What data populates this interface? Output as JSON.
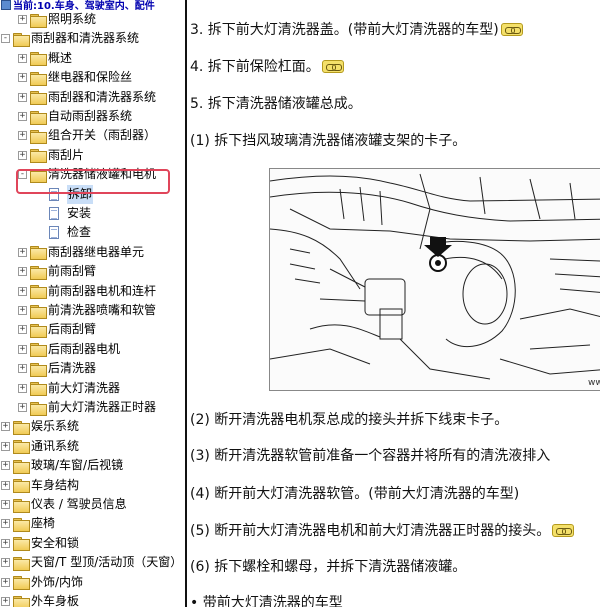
{
  "tree": {
    "header": "当前:10.车身、驾驶室内、配件",
    "items": [
      {
        "label": "照明系统",
        "level": 1,
        "type": "folder",
        "expander": "+"
      },
      {
        "label": "雨刮器和清洗器系统",
        "level": 0,
        "type": "folder",
        "expander": "-"
      },
      {
        "label": "概述",
        "level": 1,
        "type": "folder",
        "expander": "+"
      },
      {
        "label": "继电器和保险丝",
        "level": 1,
        "type": "folder",
        "expander": "+"
      },
      {
        "label": "雨刮器和清洗器系统",
        "level": 1,
        "type": "folder",
        "expander": "+"
      },
      {
        "label": "自动雨刮器系统",
        "level": 1,
        "type": "folder",
        "expander": "+"
      },
      {
        "label": "组合开关（雨刮器）",
        "level": 1,
        "type": "folder",
        "expander": "+"
      },
      {
        "label": "雨刮片",
        "level": 1,
        "type": "folder",
        "expander": "+"
      },
      {
        "label": "清洗器储液罐和电机",
        "level": 1,
        "type": "folder",
        "expander": "-"
      },
      {
        "label": "拆卸",
        "level": 2,
        "type": "doc",
        "selected": true
      },
      {
        "label": "安装",
        "level": 2,
        "type": "doc"
      },
      {
        "label": "检查",
        "level": 2,
        "type": "doc"
      },
      {
        "label": "雨刮器继电器单元",
        "level": 1,
        "type": "folder",
        "expander": "+"
      },
      {
        "label": "前雨刮臂",
        "level": 1,
        "type": "folder",
        "expander": "+"
      },
      {
        "label": "前雨刮器电机和连杆",
        "level": 1,
        "type": "folder",
        "expander": "+"
      },
      {
        "label": "前清洗器喷嘴和软管",
        "level": 1,
        "type": "folder",
        "expander": "+"
      },
      {
        "label": "后雨刮臂",
        "level": 1,
        "type": "folder",
        "expander": "+"
      },
      {
        "label": "后雨刮器电机",
        "level": 1,
        "type": "folder",
        "expander": "+"
      },
      {
        "label": "后清洗器",
        "level": 1,
        "type": "folder",
        "expander": "+"
      },
      {
        "label": "前大灯清洗器",
        "level": 1,
        "type": "folder",
        "expander": "+"
      },
      {
        "label": "前大灯清洗器正时器",
        "level": 1,
        "type": "folder",
        "expander": "+"
      },
      {
        "label": "娱乐系统",
        "level": 0,
        "type": "folder",
        "expander": "+"
      },
      {
        "label": "通讯系统",
        "level": 0,
        "type": "folder",
        "expander": "+"
      },
      {
        "label": "玻璃/车窗/后视镜",
        "level": 0,
        "type": "folder",
        "expander": "+"
      },
      {
        "label": "车身结构",
        "level": 0,
        "type": "folder",
        "expander": "+"
      },
      {
        "label": "仪表 / 驾驶员信息",
        "level": 0,
        "type": "folder",
        "expander": "+"
      },
      {
        "label": "座椅",
        "level": 0,
        "type": "folder",
        "expander": "+"
      },
      {
        "label": "安全和锁",
        "level": 0,
        "type": "folder",
        "expander": "+"
      },
      {
        "label": "天窗/T 型顶/活动顶（天窗）",
        "level": 0,
        "type": "folder",
        "expander": "+"
      },
      {
        "label": "外饰/内饰",
        "level": 0,
        "type": "folder",
        "expander": "+"
      },
      {
        "label": "外车身板",
        "level": 0,
        "type": "folder",
        "expander": "+"
      }
    ]
  },
  "content": {
    "steps": [
      {
        "text": "3. 拆下前大灯清洗器盖。(带前大灯清洗器的车型)",
        "link_icon": true
      },
      {
        "text": "4. 拆下前保险杠面。",
        "link_icon": true
      },
      {
        "text": "5. 拆下清洗器储液罐总成。",
        "link_icon": false
      },
      {
        "text": "(1) 拆下挡风玻璃清洗器储液罐支架的卡子。",
        "link_icon": false
      },
      {
        "text": "(2) 断开清洗器电机泵总成的接头并拆下线束卡子。",
        "link_icon": false
      },
      {
        "text": "(3) 断开清洗器软管前准备一个容器并将所有的清洗液排入",
        "link_icon": false
      },
      {
        "text": "(4) 断开前大灯清洗器软管。(带前大灯清洗器的车型)",
        "link_icon": false
      },
      {
        "text": "(5) 断开前大灯清洗器电机和前大灯清洗器正时器的接头。",
        "link_icon": true
      },
      {
        "text": "(6) 拆下螺栓和螺母，并拆下清洗器储液罐。",
        "link_icon": false
      },
      {
        "text": "• 带前大灯清洗器的车型",
        "link_icon": false
      }
    ],
    "figure_id": "ww-"
  },
  "colors": {
    "header_text": "#0000b0",
    "highlight_border": "#e0455a",
    "selection_bg": "#c9def7"
  }
}
